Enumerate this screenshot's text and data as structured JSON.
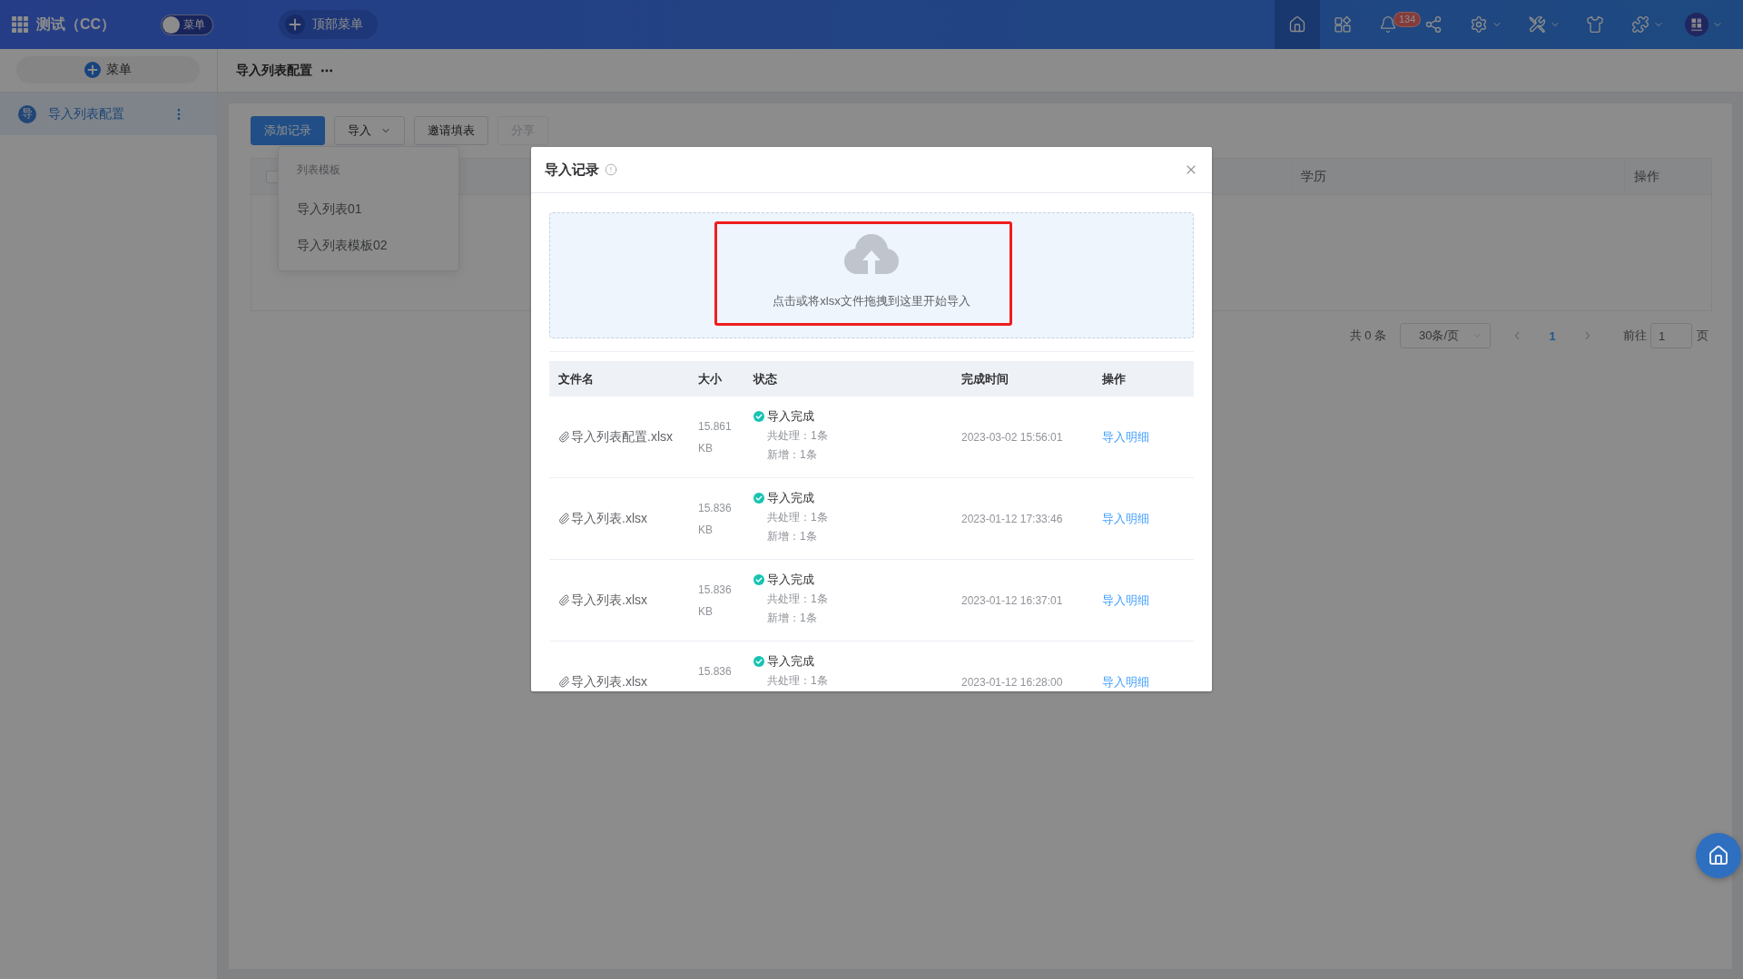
{
  "top_bar": {
    "title": "测试（CC）",
    "menu_toggle": {
      "label": "菜单",
      "on": false
    },
    "top_menu_button": {
      "label": "顶部菜单"
    },
    "icons": [
      {
        "kind": "home",
        "selected": true,
        "dropdown": false
      },
      {
        "kind": "apps",
        "selected": false,
        "dropdown": false
      },
      {
        "kind": "bell",
        "selected": false,
        "dropdown": false,
        "badge": "134"
      },
      {
        "kind": "share",
        "selected": false,
        "dropdown": false
      },
      {
        "kind": "settings",
        "selected": false,
        "dropdown": true
      },
      {
        "kind": "tools",
        "selected": false,
        "dropdown": true
      },
      {
        "kind": "shirt",
        "selected": false,
        "dropdown": false
      },
      {
        "kind": "plugin",
        "selected": false,
        "dropdown": true
      },
      {
        "kind": "avatar",
        "selected": false,
        "dropdown": true
      }
    ]
  },
  "sidebar": {
    "add_button": "菜单",
    "items": [
      {
        "initial": "导",
        "label": "导入列表配置",
        "selected": true
      }
    ]
  },
  "page_header": {
    "title": "导入列表配置"
  },
  "toolbar": {
    "buttons": [
      {
        "label": "添加记录",
        "kind": "primary",
        "disabled": false
      },
      {
        "label": "导入",
        "kind": "dropdown",
        "disabled": false
      },
      {
        "label": "邀请填表",
        "kind": "plain",
        "disabled": false
      },
      {
        "label": "分享",
        "kind": "plain",
        "disabled": true
      }
    ]
  },
  "import_menu": {
    "group_title": "列表模板",
    "items": [
      {
        "label": "导入列表01"
      },
      {
        "label": "导入列表模板02"
      }
    ]
  },
  "table": {
    "select_all": {
      "checked": false
    },
    "columns": [
      {
        "label": "学历"
      },
      {
        "label": "操作"
      }
    ]
  },
  "pagination": {
    "total": "共 0 条",
    "page_size": "30条/页",
    "pages": [
      {
        "label": "1",
        "selected": true
      }
    ],
    "goto_label": "前往",
    "goto_value": "1",
    "goto_suffix": "页"
  },
  "dialog": {
    "title": "导入记录",
    "upload": {
      "text": "点击或将xlsx文件拖拽到这里开始导入",
      "highlighted": true
    },
    "columns": [
      "文件名",
      "大小",
      "状态",
      "完成时间",
      "操作"
    ],
    "rows": [
      {
        "file": "导入列表配置.xlsx",
        "size": "15.861 KB",
        "status": {
          "label": "导入完成",
          "kind": "success"
        },
        "details": [
          "共处理：1条",
          "新增：1条"
        ],
        "time": "2023-03-02 15:56:01",
        "action": "导入明细"
      },
      {
        "file": "导入列表.xlsx",
        "size": "15.836 KB",
        "status": {
          "label": "导入完成",
          "kind": "success"
        },
        "details": [
          "共处理：1条",
          "新增：1条"
        ],
        "time": "2023-01-12 17:33:46",
        "action": "导入明细"
      },
      {
        "file": "导入列表.xlsx",
        "size": "15.836 KB",
        "status": {
          "label": "导入完成",
          "kind": "success"
        },
        "details": [
          "共处理：1条",
          "新增：1条"
        ],
        "time": "2023-01-12 16:37:01",
        "action": "导入明细"
      },
      {
        "file": "导入列表.xlsx",
        "size": "15.836",
        "status": {
          "label": "导入完成",
          "kind": "success"
        },
        "details": [
          "共处理：1条"
        ],
        "time": "2023-01-12 16:28:00",
        "action": "导入明细"
      }
    ]
  },
  "floating_button": {
    "kind": "home"
  }
}
